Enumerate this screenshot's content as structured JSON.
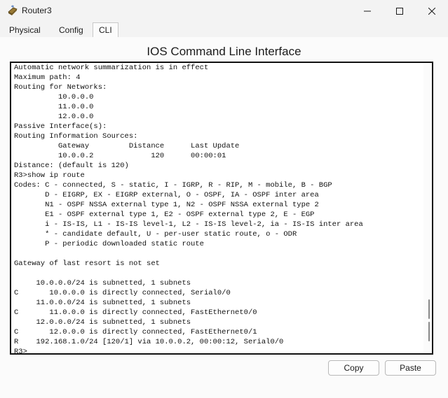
{
  "window": {
    "title": "Router3",
    "icon": "router-icon"
  },
  "tabs": [
    {
      "label": "Physical"
    },
    {
      "label": "Config"
    },
    {
      "label": "CLI",
      "active": true
    }
  ],
  "panel": {
    "title": "IOS Command Line Interface"
  },
  "cli": {
    "lines": [
      "Automatic network summarization is in effect",
      "Maximum path: 4",
      "Routing for Networks:",
      "          10.0.0.0",
      "          11.0.0.0",
      "          12.0.0.0",
      "Passive Interface(s):",
      "Routing Information Sources:",
      "          Gateway         Distance      Last Update",
      "          10.0.0.2             120      00:00:01",
      "Distance: (default is 120)",
      "R3>show ip route",
      "Codes: C - connected, S - static, I - IGRP, R - RIP, M - mobile, B - BGP",
      "       D - EIGRP, EX - EIGRP external, O - OSPF, IA - OSPF inter area",
      "       N1 - OSPF NSSA external type 1, N2 - OSPF NSSA external type 2",
      "       E1 - OSPF external type 1, E2 - OSPF external type 2, E - EGP",
      "       i - IS-IS, L1 - IS-IS level-1, L2 - IS-IS level-2, ia - IS-IS inter area",
      "       * - candidate default, U - per-user static route, o - ODR",
      "       P - periodic downloaded static route",
      "",
      "Gateway of last resort is not set",
      "",
      "     10.0.0.0/24 is subnetted, 1 subnets",
      "C       10.0.0.0 is directly connected, Serial0/0",
      "     11.0.0.0/24 is subnetted, 1 subnets",
      "C       11.0.0.0 is directly connected, FastEthernet0/0",
      "     12.0.0.0/24 is subnetted, 1 subnets",
      "C       12.0.0.0 is directly connected, FastEthernet0/1",
      "R    192.168.1.0/24 [120/1] via 10.0.0.2, 00:00:12, Serial0/0",
      "R3>"
    ]
  },
  "buttons": {
    "copy": "Copy",
    "paste": "Paste"
  }
}
